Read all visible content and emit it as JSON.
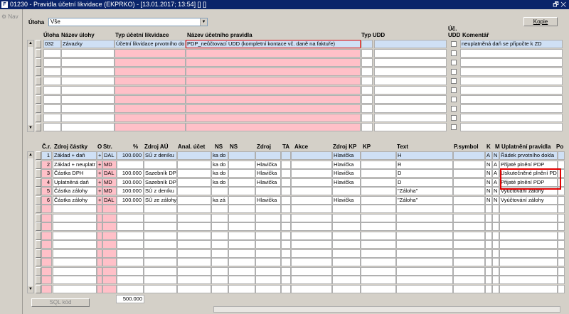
{
  "window": {
    "title": "01230 - Pravidla účetní likvidace (EKPRKO) - [13.01.2017; 13:54] [] []",
    "controls": "🗗 ✕"
  },
  "nav": {
    "label": "Nav"
  },
  "filter": {
    "label": "Úloha",
    "value": "Vše"
  },
  "kopie_button": "Kopie",
  "top": {
    "headers": {
      "uloha": "Úloha",
      "nazev_ulohy": "Název úlohy",
      "typ": "Typ účetní likvidace",
      "nazev_pravidla": "Název účetního pravidla",
      "typ_udd": "Typ UDD",
      "uc_udd_1": "Úč.",
      "uc_udd_2": "UDD",
      "komentar": "Komentář"
    },
    "rows": [
      {
        "uloha": "032",
        "nazev_ulohy": "Závazky",
        "typ": "Účetní likvidace prvotního do",
        "nazev_pravidla": "PDP_neůčtovací UDD (kompletní kontace vč. daně na faktuře)",
        "typ_udd": "",
        "komentar": "neuplatněná daň se připočte k ZD"
      },
      {
        "uloha": "",
        "nazev_ulohy": "",
        "typ": "",
        "nazev_pravidla": "",
        "typ_udd": "",
        "komentar": ""
      },
      {
        "uloha": "",
        "nazev_ulohy": "",
        "typ": "",
        "nazev_pravidla": "",
        "typ_udd": "",
        "komentar": ""
      },
      {
        "uloha": "",
        "nazev_ulohy": "",
        "typ": "",
        "nazev_pravidla": "",
        "typ_udd": "",
        "komentar": ""
      },
      {
        "uloha": "",
        "nazev_ulohy": "",
        "typ": "",
        "nazev_pravidla": "",
        "typ_udd": "",
        "komentar": ""
      },
      {
        "uloha": "",
        "nazev_ulohy": "",
        "typ": "",
        "nazev_pravidla": "",
        "typ_udd": "",
        "komentar": ""
      },
      {
        "uloha": "",
        "nazev_ulohy": "",
        "typ": "",
        "nazev_pravidla": "",
        "typ_udd": "",
        "komentar": ""
      },
      {
        "uloha": "",
        "nazev_ulohy": "",
        "typ": "",
        "nazev_pravidla": "",
        "typ_udd": "",
        "komentar": ""
      },
      {
        "uloha": "",
        "nazev_ulohy": "",
        "typ": "",
        "nazev_pravidla": "",
        "typ_udd": "",
        "komentar": ""
      },
      {
        "uloha": "",
        "nazev_ulohy": "",
        "typ": "",
        "nazev_pravidla": "",
        "typ_udd": "",
        "komentar": ""
      }
    ]
  },
  "bottom": {
    "headers": {
      "cr": "Č.r.",
      "zdroj_castky": "Zdroj částky",
      "o": "O",
      "str": "Str.",
      "pct": "%",
      "zdroj_au": "Zdroj AÚ",
      "anal_ucet": "Anal. účet",
      "ns1": "NS",
      "ns2": "NS",
      "zdroj": "Zdroj",
      "ta": "TA",
      "akce": "Akce",
      "zdroj_kp": "Zdroj KP",
      "kp": "KP",
      "text": "Text",
      "psymbol": "P.symbol",
      "k": "K",
      "m": "M",
      "uplatneni": "Uplatnění pravidla",
      "po": "Po"
    },
    "rows": [
      {
        "cr": "1",
        "zdroj_castky": "Základ + daň",
        "o": "+",
        "str": "DAL",
        "pct": "100.000",
        "zdroj_au": "SÚ z deníku",
        "ns1": "ka do",
        "zdroj": "",
        "zdroj_kp": "Hlavička",
        "text": "H",
        "k": "A",
        "m": "N",
        "uplatneni": "Řádek prvotního dokla"
      },
      {
        "cr": "2",
        "zdroj_castky": "Základ + neuplatr",
        "o": "+",
        "str": "MD",
        "pct": "",
        "zdroj_au": "",
        "ns1": "ka do",
        "zdroj": "Hlavička",
        "zdroj_kp": "Hlavička",
        "text": "R",
        "k": "N",
        "m": "A",
        "uplatneni": "Přijaté plnění PDP"
      },
      {
        "cr": "3",
        "zdroj_castky": "Částka DPH",
        "o": "+",
        "str": "DAL",
        "pct": "100.000",
        "zdroj_au": "Sazebník DPH",
        "ns1": "ka do",
        "zdroj": "Hlavička",
        "zdroj_kp": "Hlavička",
        "text": "D",
        "k": "N",
        "m": "A",
        "uplatneni": "Uskutečněné plnění PD"
      },
      {
        "cr": "4",
        "zdroj_castky": "Uplatněná daň",
        "o": "+",
        "str": "MD",
        "pct": "100.000",
        "zdroj_au": "Sazebník DPH",
        "ns1": "ka do",
        "zdroj": "Hlavička",
        "zdroj_kp": "Hlavička",
        "text": "D",
        "k": "N",
        "m": "A",
        "uplatneni": "Přijaté plnění PDP"
      },
      {
        "cr": "5",
        "zdroj_castky": "Částka zálohy",
        "o": "+",
        "str": "MD",
        "pct": "100.000",
        "zdroj_au": "SÚ z deníku",
        "ns1": "",
        "zdroj": "",
        "zdroj_kp": "",
        "text": "\"Záloha\"",
        "k": "N",
        "m": "N",
        "uplatneni": "Vyúčtování zálohy"
      },
      {
        "cr": "6",
        "zdroj_castky": "Částka zálohy",
        "o": "+",
        "str": "DAL",
        "pct": "100.000",
        "zdroj_au": "SÚ ze zálohy",
        "ns1": "ka zá",
        "zdroj": "Hlavička",
        "zdroj_kp": "Hlavička",
        "text": "\"Záloha\"",
        "k": "N",
        "m": "N",
        "uplatneni": "Vyúčtování zálohy"
      }
    ],
    "total": "500.000"
  },
  "sql_button": "SQL kód"
}
